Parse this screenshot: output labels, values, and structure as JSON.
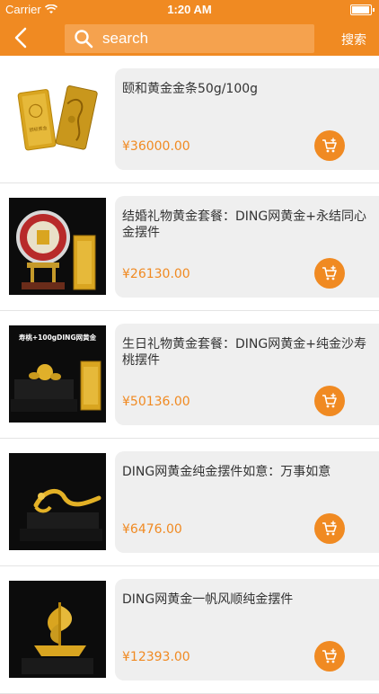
{
  "status_bar": {
    "carrier": "Carrier",
    "time": "1:20 AM",
    "battery_level": 0.95
  },
  "nav": {
    "back_icon": "chevron-left-icon",
    "search_placeholder": "search",
    "search_value": "",
    "search_button_label": "搜索"
  },
  "products": [
    {
      "title": "颐和黄金金条50g/100g",
      "price": "¥36000.00",
      "thumb": "gold-bars"
    },
    {
      "title": "结婚礼物黄金套餐：DING网黄金+永结同心金摆件",
      "price": "¥26130.00",
      "thumb": "wedding-ornament"
    },
    {
      "title": "生日礼物黄金套餐：DING网黄金+纯金沙寿桃摆件",
      "price": "¥50136.00",
      "thumb": "birthday-peach"
    },
    {
      "title": "DING网黄金纯金摆件如意：万事如意",
      "price": "¥6476.00",
      "thumb": "ruyi-ornament"
    },
    {
      "title": "DING网黄金一帆风顺纯金摆件",
      "price": "¥12393.00",
      "thumb": "sailboat-ornament"
    }
  ],
  "thumb_texts": {
    "bar_stamp": "颐和黄金",
    "birthday_banner": "寿桃+100gDING网黄金"
  },
  "colors": {
    "accent": "#f08a22",
    "card_bg": "#efefef",
    "gold": "#d9a520"
  }
}
